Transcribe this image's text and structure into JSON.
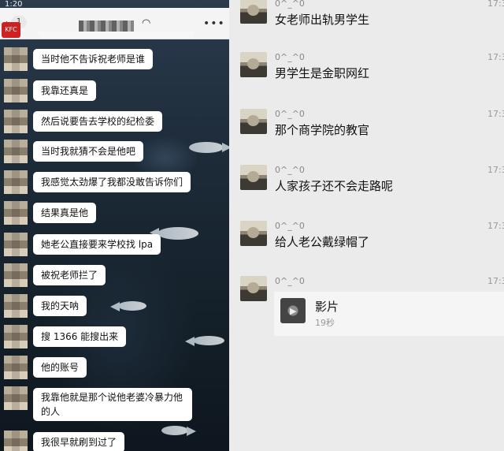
{
  "left_panel": {
    "status_time": "1:20",
    "unread_count": "1",
    "group_logo_text": "KFC",
    "more_icon_glyph": "•••",
    "messages": [
      {
        "text": "当时他不告诉祝老师是谁"
      },
      {
        "text": "我靠还真是"
      },
      {
        "text": "然后说要告去学校的纪检委"
      },
      {
        "text": "当时我就猜不会是他吧"
      },
      {
        "text": "我感觉太劲爆了我都没敢告诉你们"
      },
      {
        "text": "结果真是他"
      },
      {
        "text": "她老公直接要来学校找 lpa"
      },
      {
        "text": "被祝老师拦了"
      },
      {
        "text": "我的天呐"
      },
      {
        "text": "搜 1366 能搜出来"
      },
      {
        "text": "他的账号"
      },
      {
        "text": "我靠他就是那个说他老婆冷暴力他的人"
      },
      {
        "text": "我很早就刷到过了"
      }
    ]
  },
  "right_panel": {
    "messages": [
      {
        "name": "0^_^0",
        "time": "17:3",
        "text": "女老师出轨男学生"
      },
      {
        "name": "0^_^0",
        "time": "17:3",
        "text": "男学生是金职网红"
      },
      {
        "name": "0^_^0",
        "time": "17:3",
        "text": "那个商学院的教官"
      },
      {
        "name": "0^_^0",
        "time": "17:3",
        "text": "人家孩子还不会走路呢"
      },
      {
        "name": "0^_^0",
        "time": "17:3",
        "text": "给人老公戴绿帽了"
      },
      {
        "name": "0^_^0",
        "time": "17:3",
        "text": ""
      }
    ],
    "video": {
      "label": "影片",
      "duration": "19秒"
    }
  },
  "colors": {
    "left_bg": "#1d2b39",
    "right_bg": "#ebebeb",
    "bubble": "#ffffff"
  }
}
